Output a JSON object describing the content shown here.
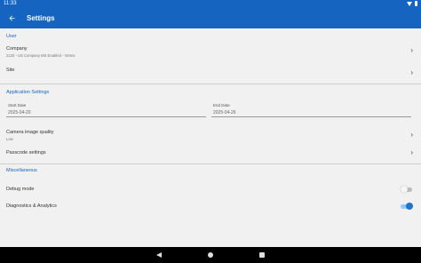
{
  "status_bar": {
    "time": "11:33"
  },
  "app_bar": {
    "title": "Settings"
  },
  "sections": {
    "user": "User",
    "application": "Application Settings",
    "misc": "Miscellaneous"
  },
  "company": {
    "label": "Company",
    "value": "2120 - US Company MS Enabled - Vertex"
  },
  "site": {
    "label": "Site"
  },
  "start_date": {
    "label": "Start Date",
    "value": "2025-04-20"
  },
  "end_date": {
    "label": "End Date",
    "value": "2025-04-26"
  },
  "camera": {
    "label": "Camera image quality",
    "value": "Low"
  },
  "passcode": {
    "label": "Passcode settings"
  },
  "debug": {
    "label": "Debug mode",
    "enabled": false
  },
  "diagnostics": {
    "label": "Diagnostics & Analytics",
    "enabled": true
  },
  "colors": {
    "primary": "#1565c0",
    "background": "#f1f1f1",
    "switch_off": "#bdbdbd",
    "switch_on": "#1976d2"
  },
  "icons": [
    "back-arrow-icon",
    "chevron-right-icon",
    "wifi-icon",
    "battery-icon",
    "nav-back-icon",
    "nav-home-icon",
    "nav-recents-icon"
  ]
}
